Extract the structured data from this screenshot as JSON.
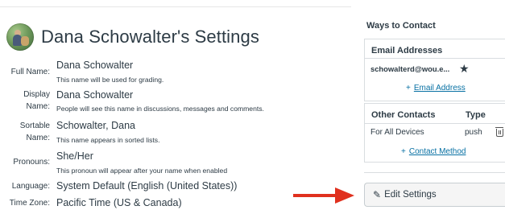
{
  "header": {
    "title": "Dana Schowalter's Settings"
  },
  "profile": {
    "full_name": {
      "label": "Full Name:",
      "value": "Dana Schowalter",
      "hint": "This name will be used for grading."
    },
    "display_name": {
      "label_line1": "Display",
      "label_line2": "Name:",
      "value": "Dana Schowalter",
      "hint": "People will see this name in discussions, messages and comments."
    },
    "sortable_name": {
      "label_line1": "Sortable",
      "label_line2": "Name:",
      "value": "Schowalter, Dana",
      "hint": "This name appears in sorted lists."
    },
    "pronouns": {
      "label": "Pronouns:",
      "value": "She/Her",
      "hint": "This pronoun will appear after your name when enabled"
    },
    "language": {
      "label": "Language:",
      "value": "System Default (English (United States))"
    },
    "time_zone": {
      "label": "Time Zone:",
      "value": "Pacific Time (US & Canada)"
    }
  },
  "ways_to_contact": {
    "title": "Ways to Contact",
    "email_header": "Email Addresses",
    "email": "schowalterd@wou.e...",
    "add_email": {
      "plus": "+",
      "label": "Email Address"
    },
    "other_header": "Other Contacts",
    "type_header": "Type",
    "contacts": [
      {
        "name": "For All Devices",
        "type": "push"
      }
    ],
    "add_contact": {
      "plus": "+",
      "label": "Contact Method"
    }
  },
  "edit_button": {
    "label": "Edit Settings"
  },
  "colors": {
    "text": "#2d3b45",
    "link": "#0770a3",
    "arrow": "#e0301e",
    "button_bg": "#f5f5f5"
  },
  "icons": [
    "avatar",
    "star-icon",
    "trash-icon",
    "pencil-icon",
    "red-arrow"
  ]
}
